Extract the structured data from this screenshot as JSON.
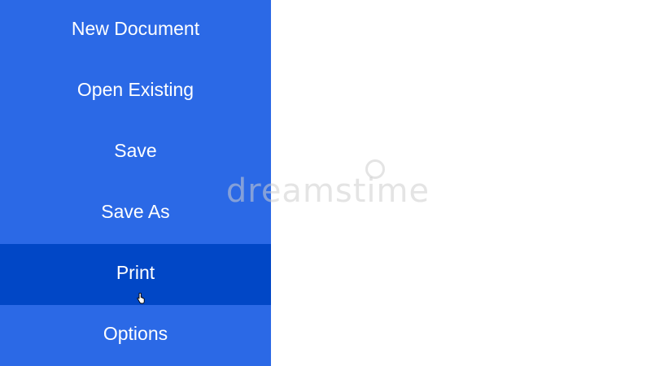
{
  "menu": {
    "items": [
      {
        "label": "New Document",
        "active": false
      },
      {
        "label": "Open Existing",
        "active": false
      },
      {
        "label": "Save",
        "active": false
      },
      {
        "label": "Save As",
        "active": false
      },
      {
        "label": "Print",
        "active": true
      },
      {
        "label": "Options",
        "active": false
      }
    ]
  },
  "watermark": {
    "text": "dreamstime"
  },
  "colors": {
    "menu_background": "#2b69e6",
    "menu_active_background": "#0147c6",
    "menu_text": "#ffffff",
    "page_background": "#ffffff"
  },
  "icons": {
    "cursor": "hand-pointer-icon"
  }
}
